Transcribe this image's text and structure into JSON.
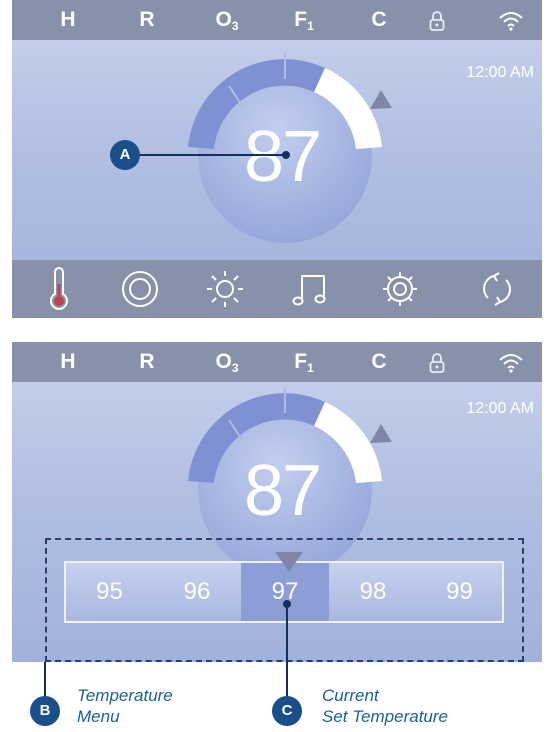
{
  "status_bar": {
    "items": [
      "H",
      "R",
      "O",
      "F",
      "C"
    ],
    "subscripts": {
      "o3": "3",
      "f1": "1"
    },
    "icons": [
      "lock-icon",
      "wifi-icon"
    ]
  },
  "panel1": {
    "clock": "12:00 AM",
    "temperature": "87",
    "callout_a": "A",
    "nav_icons": [
      "thermometer-icon",
      "target-icon",
      "light-icon",
      "music-icon",
      "settings-icon",
      "cycle-icon"
    ]
  },
  "panel2": {
    "clock": "12:00 AM",
    "temperature": "87",
    "menu": [
      "95",
      "96",
      "97",
      "98",
      "99"
    ],
    "selected": "97"
  },
  "annotations": {
    "b_badge": "B",
    "b_line1": "Temperature",
    "b_line2": "Menu",
    "c_badge": "C",
    "c_line1": "Current",
    "c_line2": "Set Temperature"
  },
  "colors": {
    "bar": "#8791aa",
    "screen_top": "#c9d3ec",
    "screen_bottom": "#a2b1dc",
    "gauge_fill": "#7f91d2",
    "callout": "#1a4f8c",
    "thermometer": "#c4424d",
    "label": "#1a5f99"
  }
}
